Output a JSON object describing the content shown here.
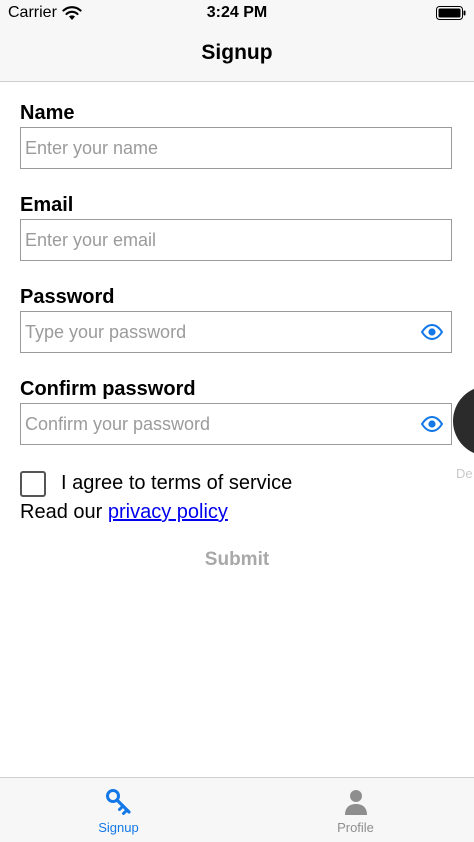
{
  "status_bar": {
    "carrier": "Carrier",
    "time": "3:24 PM"
  },
  "nav": {
    "title": "Signup"
  },
  "form": {
    "name": {
      "label": "Name",
      "placeholder": "Enter your name",
      "value": ""
    },
    "email": {
      "label": "Email",
      "placeholder": "Enter your email",
      "value": ""
    },
    "password": {
      "label": "Password",
      "placeholder": "Type your password",
      "value": "",
      "toggle_icon": "eye-icon"
    },
    "confirm_password": {
      "label": "Confirm password",
      "placeholder": "Confirm your password",
      "value": "",
      "toggle_icon": "eye-icon"
    },
    "terms": {
      "label": "I agree to terms of service",
      "checked": false
    },
    "privacy": {
      "prefix": "Read our ",
      "link": "privacy policy"
    },
    "submit_label": "Submit"
  },
  "floating": {
    "label": "De"
  },
  "tabs": [
    {
      "label": "Signup",
      "icon": "key-icon",
      "active": true
    },
    {
      "label": "Profile",
      "icon": "person-icon",
      "active": false
    }
  ],
  "colors": {
    "accent": "#1478e8",
    "inactive_tab": "#8e8e8e",
    "disabled_text": "#a8a8a8",
    "link": "#0000ee",
    "bar_background": "#f7f7f7"
  }
}
